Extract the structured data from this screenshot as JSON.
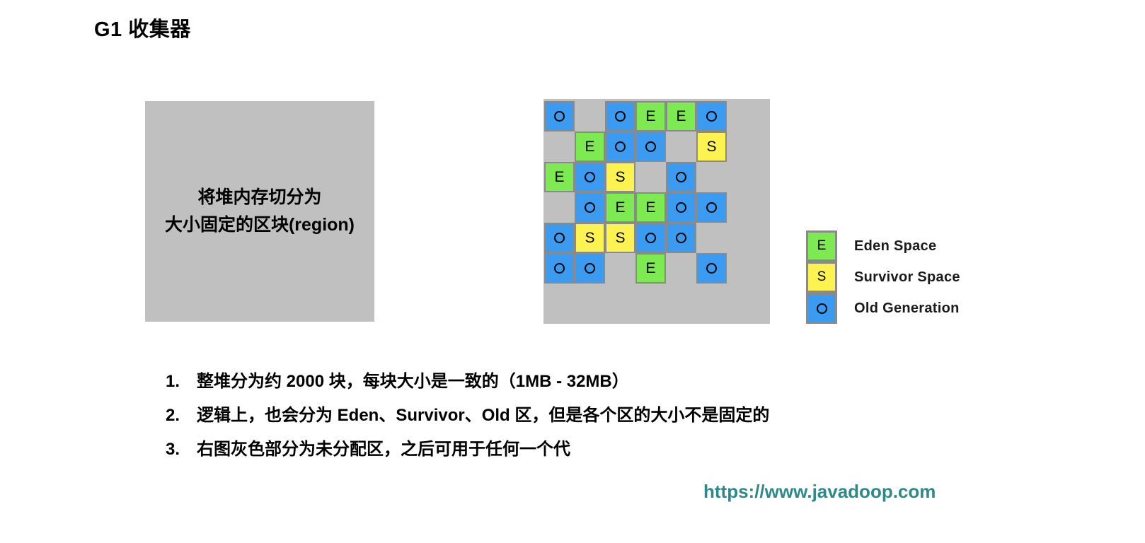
{
  "title": "G1 收集器",
  "left_panel": {
    "text": "将堆内存切分为\n大小固定的区块(region)",
    "background_color": "#c0c0c0"
  },
  "region_panel": {
    "background_color": "#c0c0c0",
    "colors": {
      "eden": "#7dea51",
      "survivor": "#fcf250",
      "old": "#3a9bf0",
      "unallocated": "#c0c0c0",
      "border": "#8a8a8a"
    },
    "rows": 6,
    "cols": 6,
    "grid": [
      [
        "O",
        "",
        "O",
        "E",
        "E",
        "O"
      ],
      [
        "",
        "E",
        "O",
        "O",
        "",
        "S"
      ],
      [
        "E",
        "O",
        "S",
        "",
        "O",
        ""
      ],
      [
        "",
        "O",
        "E",
        "E",
        "O",
        "O"
      ],
      [
        "O",
        "S",
        "S",
        "O",
        "O",
        ""
      ],
      [
        "O",
        "O",
        "",
        "E",
        "",
        "O"
      ]
    ]
  },
  "legend": {
    "items": [
      {
        "symbol": "E",
        "label": "Eden Space",
        "type": "eden"
      },
      {
        "symbol": "S",
        "label": "Survivor Space",
        "type": "survivor"
      },
      {
        "symbol": "O",
        "label": "Old Generation",
        "type": "old"
      }
    ]
  },
  "notes": [
    {
      "number": "1.",
      "text": "整堆分为约 2000 块，每块大小是一致的（1MB - 32MB）"
    },
    {
      "number": "2.",
      "text": "逻辑上，也会分为 Eden、Survivor、Old 区，但是各个区的大小不是固定的"
    },
    {
      "number": "3.",
      "text": "右图灰色部分为未分配区，之后可用于任何一个代"
    }
  ],
  "footer": {
    "url": "https://www.javadoop.com",
    "color": "#2d8a8a"
  }
}
